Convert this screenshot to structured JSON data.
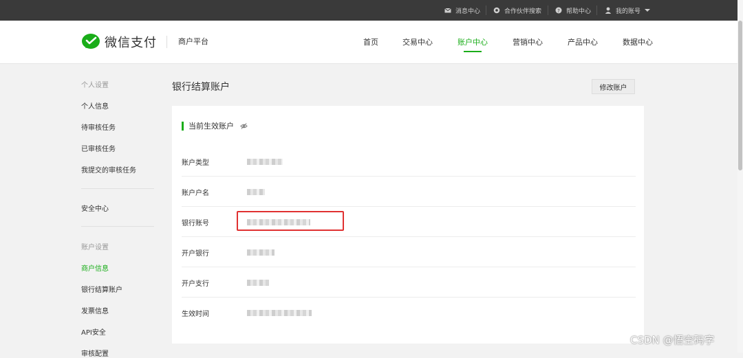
{
  "topbar": {
    "messages": "消息中心",
    "partner_search": "合作伙伴搜索",
    "help": "帮助中心",
    "account": "我的账号"
  },
  "header": {
    "brand": "微信支付",
    "platform": "商户平台",
    "nav": [
      "首页",
      "交易中心",
      "账户中心",
      "营销中心",
      "产品中心",
      "数据中心"
    ],
    "active_nav": "账户中心"
  },
  "sidebar": {
    "group_personal": "个人设置",
    "personal_info": "个人信息",
    "pending_tasks": "待审核任务",
    "reviewed_tasks": "已审核任务",
    "submitted_tasks": "我提交的审核任务",
    "security_center": "安全中心",
    "group_account": "账户设置",
    "merchant_info": "商户信息",
    "bank_settlement": "银行结算账户",
    "invoice_info": "发票信息",
    "api_security": "API安全",
    "partial_item": "审核配置"
  },
  "main": {
    "title": "银行结算账户",
    "edit_button": "修改账户",
    "section_title": "当前生效账户",
    "rows": [
      {
        "label": "账户类型"
      },
      {
        "label": "账户户名"
      },
      {
        "label": "银行账号"
      },
      {
        "label": "开户银行"
      },
      {
        "label": "开户支行"
      },
      {
        "label": "生效时间"
      }
    ]
  },
  "watermark": "CSDN @悟空码字",
  "colors": {
    "accent": "#1aad19",
    "highlight": "#e03030",
    "topbar": "#3a3a3a"
  },
  "icons": [
    "mail-icon",
    "partner-icon",
    "help-icon",
    "user-icon",
    "chevron-down-icon",
    "wechat-pay-logo-icon",
    "eye-off-icon"
  ]
}
